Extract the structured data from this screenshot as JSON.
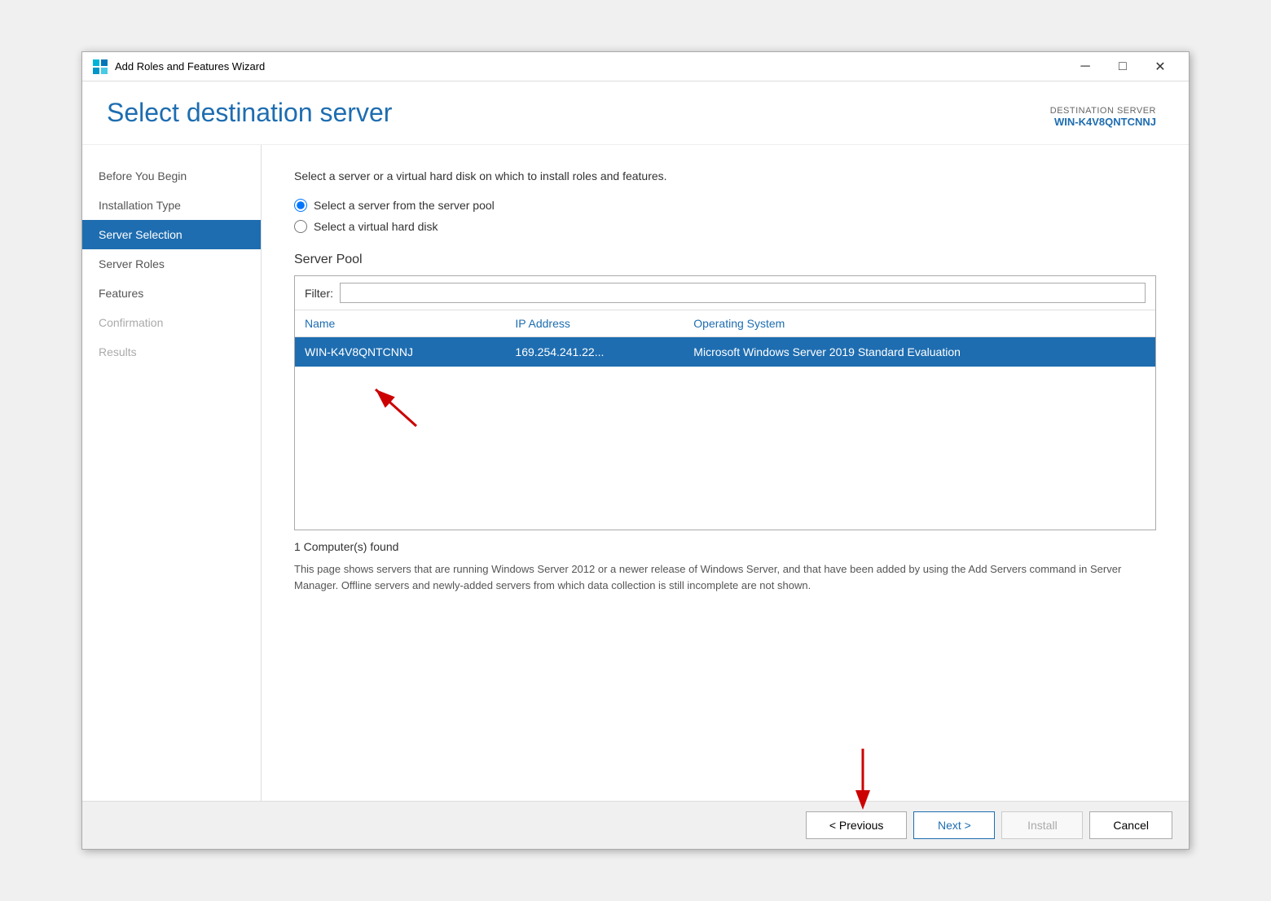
{
  "window": {
    "title": "Add Roles and Features Wizard",
    "minimize": "─",
    "maximize": "□",
    "close": "✕"
  },
  "header": {
    "title": "Select destination server",
    "destination_label": "DESTINATION SERVER",
    "destination_name": "WIN-K4V8QNTCNNJ"
  },
  "sidebar": {
    "items": [
      {
        "label": "Before You Begin",
        "state": "normal"
      },
      {
        "label": "Installation Type",
        "state": "normal"
      },
      {
        "label": "Server Selection",
        "state": "active"
      },
      {
        "label": "Server Roles",
        "state": "normal"
      },
      {
        "label": "Features",
        "state": "normal"
      },
      {
        "label": "Confirmation",
        "state": "disabled"
      },
      {
        "label": "Results",
        "state": "disabled"
      }
    ]
  },
  "main": {
    "intro_text": "Select a server or a virtual hard disk on which to install roles and features.",
    "radio_options": [
      {
        "label": "Select a server from the server pool",
        "checked": true
      },
      {
        "label": "Select a virtual hard disk",
        "checked": false
      }
    ],
    "server_pool_title": "Server Pool",
    "filter_label": "Filter:",
    "filter_placeholder": "",
    "table": {
      "columns": [
        "Name",
        "IP Address",
        "Operating System"
      ],
      "rows": [
        {
          "name": "WIN-K4V8QNTCNNJ",
          "ip": "169.254.241.22...",
          "os": "Microsoft Windows Server 2019 Standard Evaluation",
          "selected": true
        }
      ]
    },
    "computers_found": "1 Computer(s) found",
    "info_text": "This page shows servers that are running Windows Server 2012 or a newer release of Windows Server, and that have been added by using the Add Servers command in Server Manager. Offline servers and newly-added servers from which data collection is still incomplete are not shown."
  },
  "footer": {
    "previous_label": "< Previous",
    "next_label": "Next >",
    "install_label": "Install",
    "cancel_label": "Cancel"
  }
}
